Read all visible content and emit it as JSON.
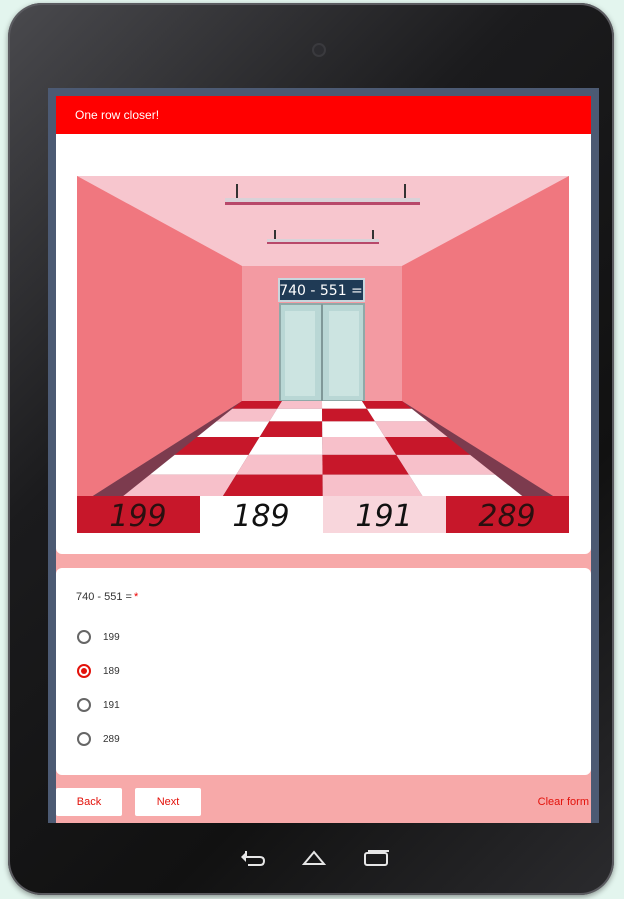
{
  "form": {
    "banner_title": "One row closer!",
    "question": {
      "prompt": "740 - 551 =",
      "required_mark": "*",
      "options": [
        "199",
        "189",
        "191",
        "289"
      ],
      "selected": "189"
    },
    "back_label": "Back",
    "next_label": "Next",
    "clear_label": "Clear form"
  },
  "scene": {
    "elevator_sign": "740 - 551 =",
    "floor_numbers": [
      "199",
      "189",
      "191",
      "289"
    ]
  },
  "device": {
    "nav_icons": [
      "back-icon",
      "home-icon",
      "recents-icon"
    ]
  },
  "colors": {
    "accent": "#ff0000",
    "accent_text": "#e3120b",
    "form_background": "#f7a9a9"
  }
}
